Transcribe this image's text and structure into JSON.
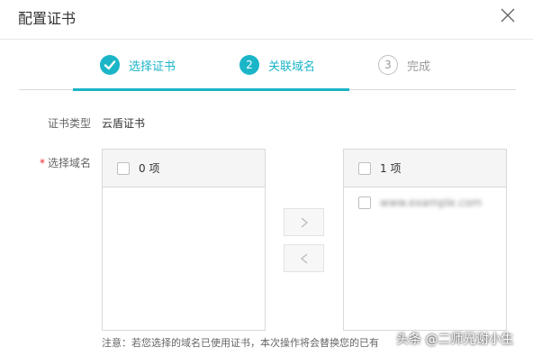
{
  "dialog": {
    "title": "配置证书"
  },
  "steps": [
    {
      "number": "1",
      "label": "选择证书",
      "state": "done"
    },
    {
      "number": "2",
      "label": "关联域名",
      "state": "active"
    },
    {
      "number": "3",
      "label": "完成",
      "state": "pending"
    }
  ],
  "form": {
    "cert_type_label": "证书类型",
    "cert_type_value": "云盾证书",
    "domain_required_mark": "*",
    "domain_label": "选择域名"
  },
  "transfer": {
    "left": {
      "count_label": "0 项",
      "items": []
    },
    "right": {
      "count_label": "1 项",
      "items": [
        {
          "text": "www.example.com"
        }
      ]
    }
  },
  "note": "注意：若您选择的域名已使用证书，本次操作将会替换您的已有",
  "watermark": "头条 @二师兄谢小生",
  "colors": {
    "accent": "#1bb5c8",
    "required": "#f5222d",
    "pending": "#9a9a9a"
  },
  "icons": {
    "close": "close-icon",
    "step_done": "check-icon",
    "move_right": "chevron-right-icon",
    "move_left": "chevron-left-icon"
  }
}
